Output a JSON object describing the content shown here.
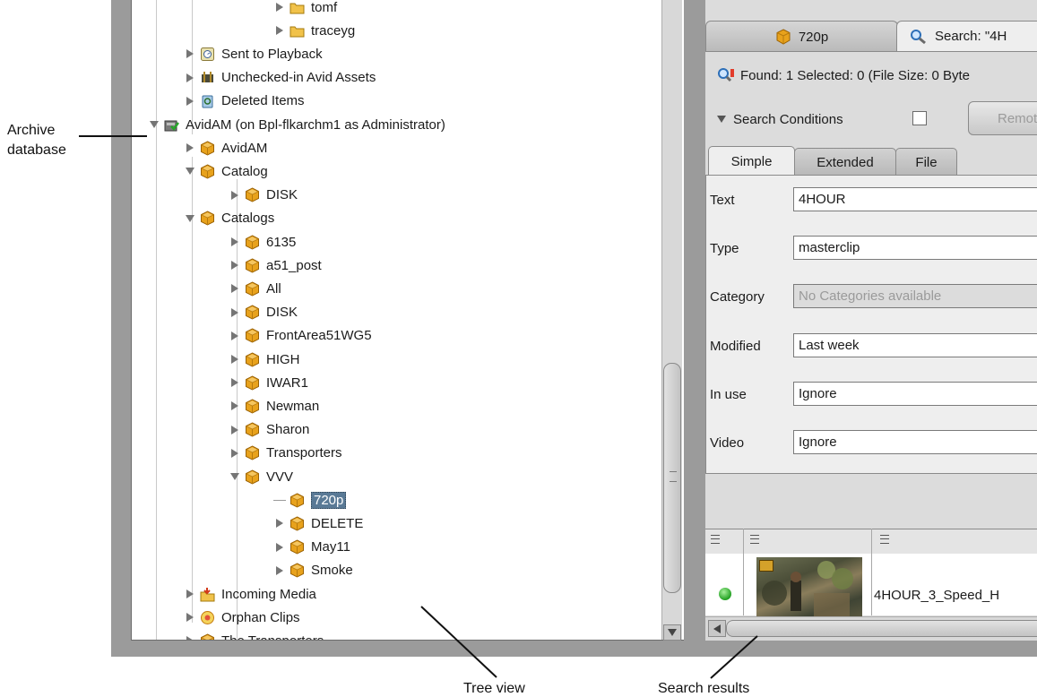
{
  "tree": {
    "nodes": [
      {
        "label": "tomf",
        "icon": "folder-icon",
        "state": "collapsed",
        "level": 4
      },
      {
        "label": "traceyg",
        "icon": "folder-icon",
        "state": "collapsed",
        "level": 4
      },
      {
        "label": "Sent to Playback",
        "icon": "playback-icon",
        "state": "collapsed",
        "level": 2
      },
      {
        "label": "Unchecked-in Avid Assets",
        "icon": "unchecked-assets-icon",
        "state": "collapsed",
        "level": 2
      },
      {
        "label": "Deleted Items",
        "icon": "recycle-bin-icon",
        "state": "collapsed",
        "level": 2
      },
      {
        "label": "AvidAM (on Bpl-flkarchm1 as Administrator)",
        "icon": "archive-database-icon",
        "state": "expanded",
        "level": 1
      },
      {
        "label": "AvidAM",
        "icon": "cube-icon",
        "state": "collapsed",
        "level": 2
      },
      {
        "label": "Catalog",
        "icon": "cube-icon",
        "state": "expanded",
        "level": 2
      },
      {
        "label": "DISK",
        "icon": "cube-icon",
        "state": "collapsed",
        "level": 3
      },
      {
        "label": "Catalogs",
        "icon": "cube-icon",
        "state": "expanded",
        "level": 2
      },
      {
        "label": "6135",
        "icon": "cube-icon",
        "state": "collapsed",
        "level": 3
      },
      {
        "label": "a51_post",
        "icon": "cube-icon",
        "state": "collapsed",
        "level": 3
      },
      {
        "label": "All",
        "icon": "cube-icon",
        "state": "collapsed",
        "level": 3
      },
      {
        "label": "DISK",
        "icon": "cube-icon",
        "state": "collapsed",
        "level": 3
      },
      {
        "label": "FrontArea51WG5",
        "icon": "cube-icon",
        "state": "collapsed",
        "level": 3
      },
      {
        "label": "HIGH",
        "icon": "cube-icon",
        "state": "collapsed",
        "level": 3
      },
      {
        "label": "IWAR1",
        "icon": "cube-icon",
        "state": "collapsed",
        "level": 3
      },
      {
        "label": "Newman",
        "icon": "cube-icon",
        "state": "collapsed",
        "level": 3
      },
      {
        "label": "Sharon",
        "icon": "cube-icon",
        "state": "collapsed",
        "level": 3
      },
      {
        "label": "Transporters",
        "icon": "cube-icon",
        "state": "collapsed",
        "level": 3
      },
      {
        "label": "VVV",
        "icon": "cube-icon",
        "state": "expanded",
        "level": 3
      },
      {
        "label": "720p",
        "icon": "cube-icon",
        "state": "leaf",
        "level": 4,
        "selected": true
      },
      {
        "label": "DELETE",
        "icon": "cube-icon",
        "state": "collapsed",
        "level": 4
      },
      {
        "label": "May11",
        "icon": "cube-icon",
        "state": "collapsed",
        "level": 4
      },
      {
        "label": "Smoke",
        "icon": "cube-icon",
        "state": "collapsed",
        "level": 4
      },
      {
        "label": "Incoming Media",
        "icon": "incoming-media-icon",
        "state": "collapsed",
        "level": 2
      },
      {
        "label": "Orphan Clips",
        "icon": "orphan-clips-icon",
        "state": "collapsed",
        "level": 2
      },
      {
        "label": "The Transporters",
        "icon": "cube-icon",
        "state": "collapsed",
        "level": 2
      }
    ]
  },
  "right": {
    "tabs": {
      "tab1": "720p",
      "tab2": "Search: \"4H"
    },
    "found_text": "Found: 1 Selected: 0 (File Size: 0 Byte",
    "search_conditions_label": "Search Conditions",
    "remote_label": "Remote",
    "subtabs": {
      "simple": "Simple",
      "extended": "Extended",
      "file": "File"
    },
    "fields": {
      "text": {
        "label": "Text",
        "value": "4HOUR"
      },
      "type": {
        "label": "Type",
        "value": "masterclip"
      },
      "category": {
        "label": "Category",
        "value": "No Categories available"
      },
      "modified": {
        "label": "Modified",
        "value": "Last week"
      },
      "in_use": {
        "label": "In use",
        "value": "Ignore"
      },
      "video": {
        "label": "Video",
        "value": "Ignore"
      }
    },
    "results": {
      "name": "4HOUR_3_Speed_H"
    }
  },
  "callouts": {
    "archive_db": "Archive\ndatabase",
    "tree_view": "Tree view",
    "search_results": "Search results"
  },
  "colors": {
    "selection": "#5a7a96",
    "cube": "#e8a21c",
    "found_ok": "#22a022"
  }
}
